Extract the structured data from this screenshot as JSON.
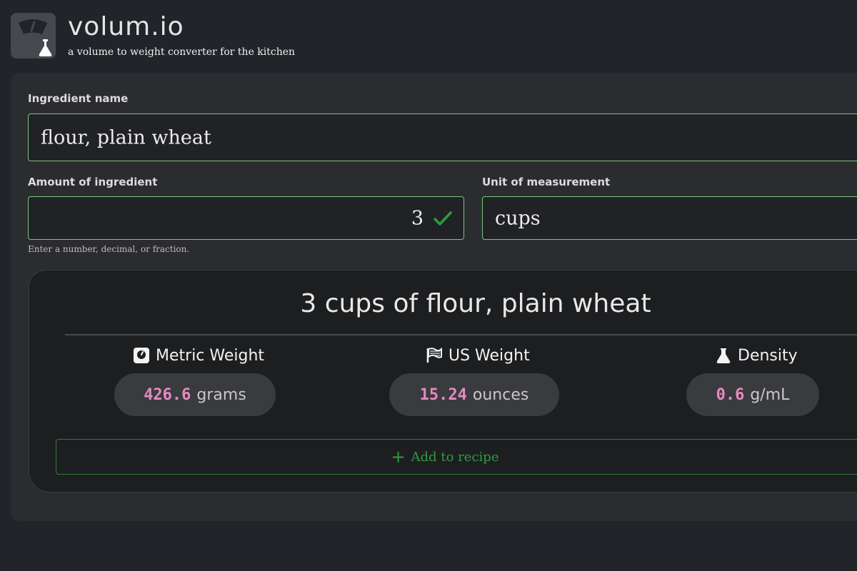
{
  "app": {
    "title": "volum.io",
    "subtitle": "a volume to weight converter for the kitchen",
    "logo_icon": "scale-flask-icon"
  },
  "form": {
    "ingredient_label": "Ingredient name",
    "ingredient_value": "flour, plain wheat",
    "amount_label": "Amount of ingredient",
    "amount_value": "3",
    "amount_valid_icon": "checkmark-icon",
    "amount_hint": "Enter a number, decimal, or fraction.",
    "unit_label": "Unit of measurement",
    "unit_value": "cups"
  },
  "result": {
    "amount": "3",
    "unit": "cups",
    "of": "of",
    "ingredient": "flour, plain wheat",
    "metrics": [
      {
        "icon": "scale-icon",
        "label": "Metric Weight",
        "value": "426.6",
        "unit": "grams"
      },
      {
        "icon": "flag-icon",
        "label": "US Weight",
        "value": "15.24",
        "unit": "ounces"
      },
      {
        "icon": "flask-icon",
        "label": "Density",
        "value": "0.6",
        "unit": "g/mL"
      }
    ],
    "add_button_label": "Add to recipe"
  },
  "colors": {
    "accent_green": "#7bc57d",
    "button_green": "#2f9b43",
    "number_pink": "#e58ac0",
    "background": "#212429",
    "panel": "#2b2c2f"
  }
}
